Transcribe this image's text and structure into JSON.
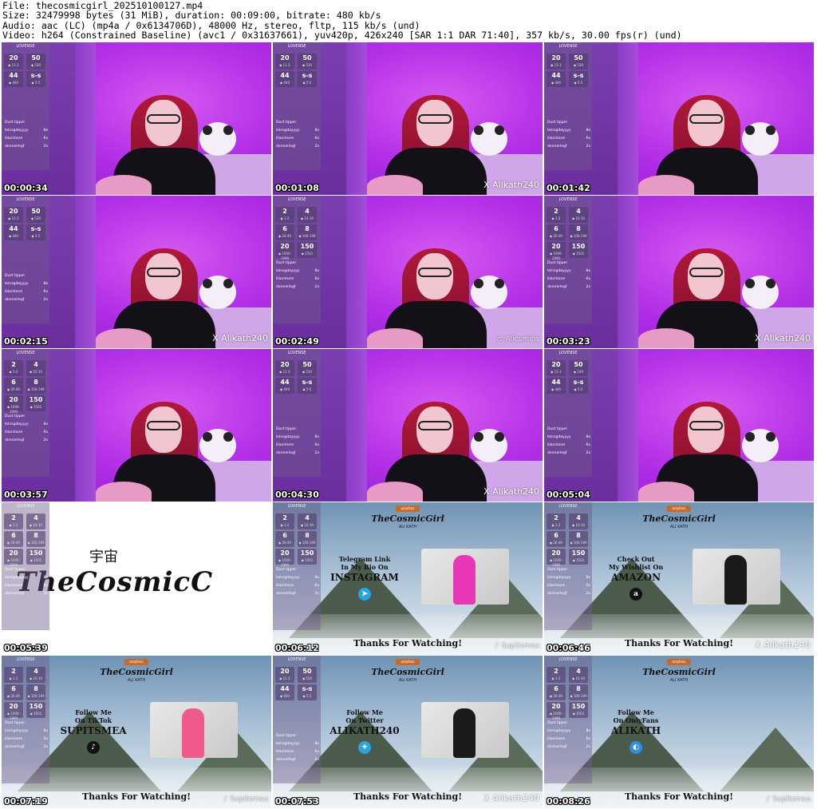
{
  "header": {
    "line1": "File: thecosmicgirl_202510100127.mp4",
    "line2": "Size: 32479998 bytes (31 MiB), duration: 00:09:00, bitrate: 480 kb/s",
    "line3": "Audio: aac (LC) (mp4a / 0x6134706D), 48000 Hz, stereo, fltp, 115 kb/s (und)",
    "line4": "Video: h264 (Constrained Baseline) (avc1 / 0x31637661), yuv420p, 426x240 [SAR 1:1 DAR 71:40], 357 kb/s, 30.00 fps(r) (und)"
  },
  "widget": {
    "title": "LOVENSE",
    "cells_a": [
      {
        "n": "20",
        "s": "◆ 11-2"
      },
      {
        "n": "50",
        "s": "◆ 530"
      },
      {
        "n": "44",
        "s": "◆ 440"
      },
      {
        "n": "s-s",
        "s": "◆ 5-5"
      }
    ],
    "cells_b": [
      {
        "n": "2",
        "s": "◆ 1-2"
      },
      {
        "n": "4",
        "s": "◆ 10-19"
      },
      {
        "n": "6",
        "s": "◆ 20-49"
      },
      {
        "n": "8",
        "s": "◆ 100-199"
      },
      {
        "n": "20",
        "s": "◆ 1000-1999"
      },
      {
        "n": "150",
        "s": "◆ 1501"
      }
    ],
    "tip_title": "Dust tipper",
    "tips": [
      {
        "name": "leinsgdayyyy",
        "val": "8x"
      },
      {
        "name": "lilanimore",
        "val": "6x"
      },
      {
        "name": "donnerlegf",
        "val": "2x"
      }
    ]
  },
  "tiles": [
    {
      "time": "00:00:34",
      "kind": "room",
      "widget": "a",
      "handle": ""
    },
    {
      "time": "00:01:08",
      "kind": "room",
      "widget": "a",
      "handle": "X Alikath240"
    },
    {
      "time": "00:01:42",
      "kind": "room",
      "widget": "a",
      "handle": ""
    },
    {
      "time": "00:02:15",
      "kind": "room",
      "widget": "a",
      "handle": "X Alikath240"
    },
    {
      "time": "00:02:49",
      "kind": "room",
      "widget": "b",
      "handle": "♂ Alicsmips"
    },
    {
      "time": "00:03:23",
      "kind": "room",
      "widget": "b",
      "handle": "X Alikath240"
    },
    {
      "time": "00:03:57",
      "kind": "room",
      "widget": "b",
      "handle": ""
    },
    {
      "time": "00:04:30",
      "kind": "room",
      "widget": "a",
      "handle": "X Alikath240"
    },
    {
      "time": "00:05:04",
      "kind": "room",
      "widget": "a",
      "handle": ""
    },
    {
      "time": "00:05:39",
      "kind": "logo",
      "widget": "b",
      "handle": ""
    },
    {
      "time": "00:06:12",
      "kind": "banner",
      "widget": "b",
      "handle": "♪ Supitsmea",
      "cta1": "Telegram Link",
      "cta2": "In My Bio On",
      "cta_big": "INSTAGRAM",
      "icon": "➤",
      "icon_color": "#2aa3df",
      "fig_color": "#e838b8"
    },
    {
      "time": "00:06:46",
      "kind": "banner",
      "widget": "b",
      "handle": "X Alikath240",
      "cta1": "Check Out",
      "cta2": "My Wishlist On",
      "cta_big": "AMAZON",
      "icon": "a",
      "icon_color": "#111111",
      "fig_color": "#1a1a1a"
    },
    {
      "time": "00:07:19",
      "kind": "banner",
      "widget": "b",
      "handle": "♪ Supitsmea",
      "cta1": "Follow Me",
      "cta2": "On TikTok",
      "cta_big": "SUPITSMEA",
      "icon": "♪",
      "icon_color": "#111111",
      "fig_color": "#f05a8a"
    },
    {
      "time": "00:07:53",
      "kind": "banner",
      "widget": "a",
      "handle": "X Alikath240",
      "cta1": "Follow Me",
      "cta2": "On Twitter",
      "cta_big": "ALIKATH240",
      "icon": "✦",
      "icon_color": "#2aa3df",
      "fig_color": "#1a1a1a"
    },
    {
      "time": "00:08:26",
      "kind": "banner",
      "widget": "b",
      "handle": "♪ Supitsmea",
      "cta1": "Follow Me",
      "cta2": "On OnlyFans",
      "cta_big": "ALIKATH",
      "icon": "◐",
      "icon_color": "#2a8fe0",
      "fig_color": ""
    }
  ],
  "banner": {
    "tag": "onlyfans",
    "brand": "TheCosmicGirl",
    "sub": "ALI KATH",
    "thanks": "Thanks For Watching!"
  },
  "logo": {
    "cn": "宇宙",
    "wordmark": "TheCosmicC"
  }
}
